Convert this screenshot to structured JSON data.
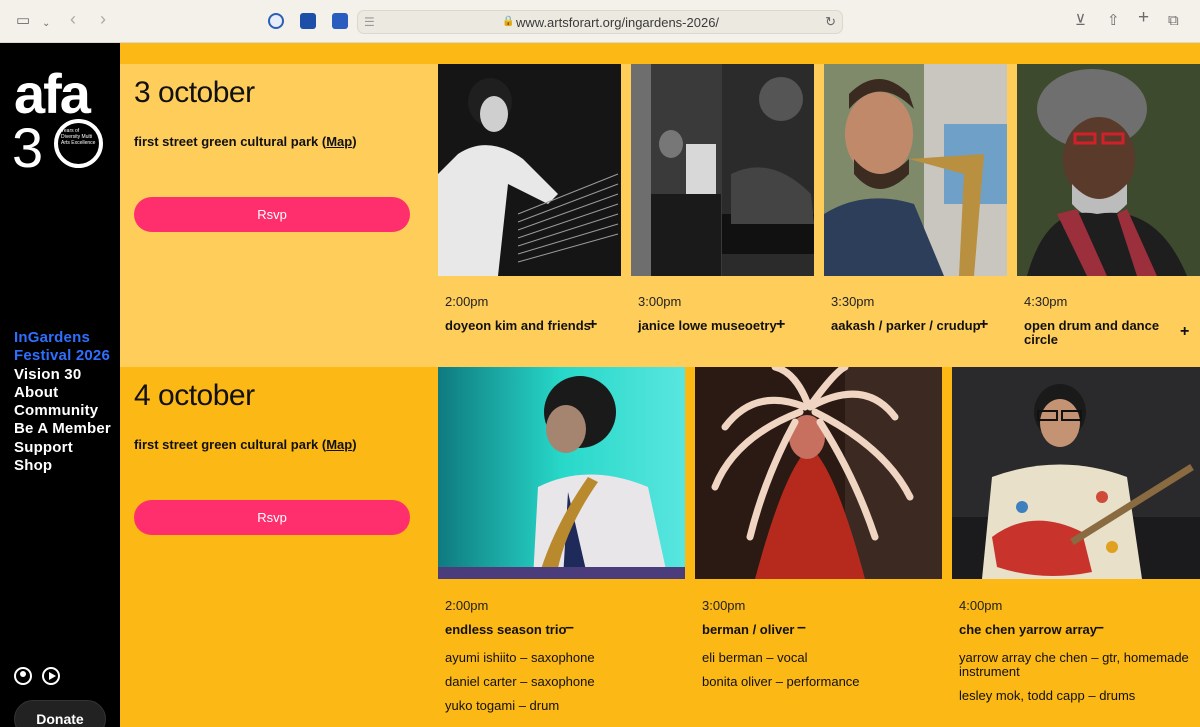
{
  "browser": {
    "url": "www.artsforart.org/ingardens-2026/"
  },
  "sidebar": {
    "logo_text": "afa",
    "logo_number": "3",
    "logo_tagline": "Years of Diversity Multi Arts Excellence",
    "nav": [
      {
        "label": "InGardens Festival 2026",
        "active": true
      },
      {
        "label": "Vision 30",
        "active": false
      },
      {
        "label": "About",
        "active": false
      },
      {
        "label": "Community",
        "active": false
      },
      {
        "label": "Be A Member",
        "active": false
      },
      {
        "label": "Support",
        "active": false
      },
      {
        "label": "Shop",
        "active": false
      }
    ],
    "donate_label": "Donate"
  },
  "days": [
    {
      "date": "3 october",
      "venue": "first street green cultural park",
      "map_label": "Map",
      "rsvp_label": "Rsvp",
      "acts": [
        {
          "time": "2:00pm",
          "name": "doyeon kim and friends",
          "toggle": "+",
          "members": []
        },
        {
          "time": "3:00pm",
          "name": "janice lowe museoetry",
          "toggle": "+",
          "members": []
        },
        {
          "time": "3:30pm",
          "name": "aakash / parker / crudup",
          "toggle": "+",
          "members": []
        },
        {
          "time": "4:30pm",
          "name": "open drum and dance circle",
          "toggle": "+",
          "members": []
        }
      ]
    },
    {
      "date": "4 october",
      "venue": "first street green cultural park",
      "map_label": "Map",
      "rsvp_label": "Rsvp",
      "acts": [
        {
          "time": "2:00pm",
          "name": "endless season trio",
          "toggle": "–",
          "members": [
            "ayumi ishiito – saxophone",
            "daniel carter – saxophone",
            "yuko togami – drum"
          ]
        },
        {
          "time": "3:00pm",
          "name": "berman / oliver",
          "toggle": "–",
          "members": [
            "eli berman – vocal",
            "bonita oliver – performance"
          ]
        },
        {
          "time": "4:00pm",
          "name": "che chen yarrow array",
          "toggle": "–",
          "members": [
            "yarrow array che chen – gtr, homemade instrument",
            "lesley mok, todd capp – drums"
          ]
        }
      ]
    }
  ]
}
